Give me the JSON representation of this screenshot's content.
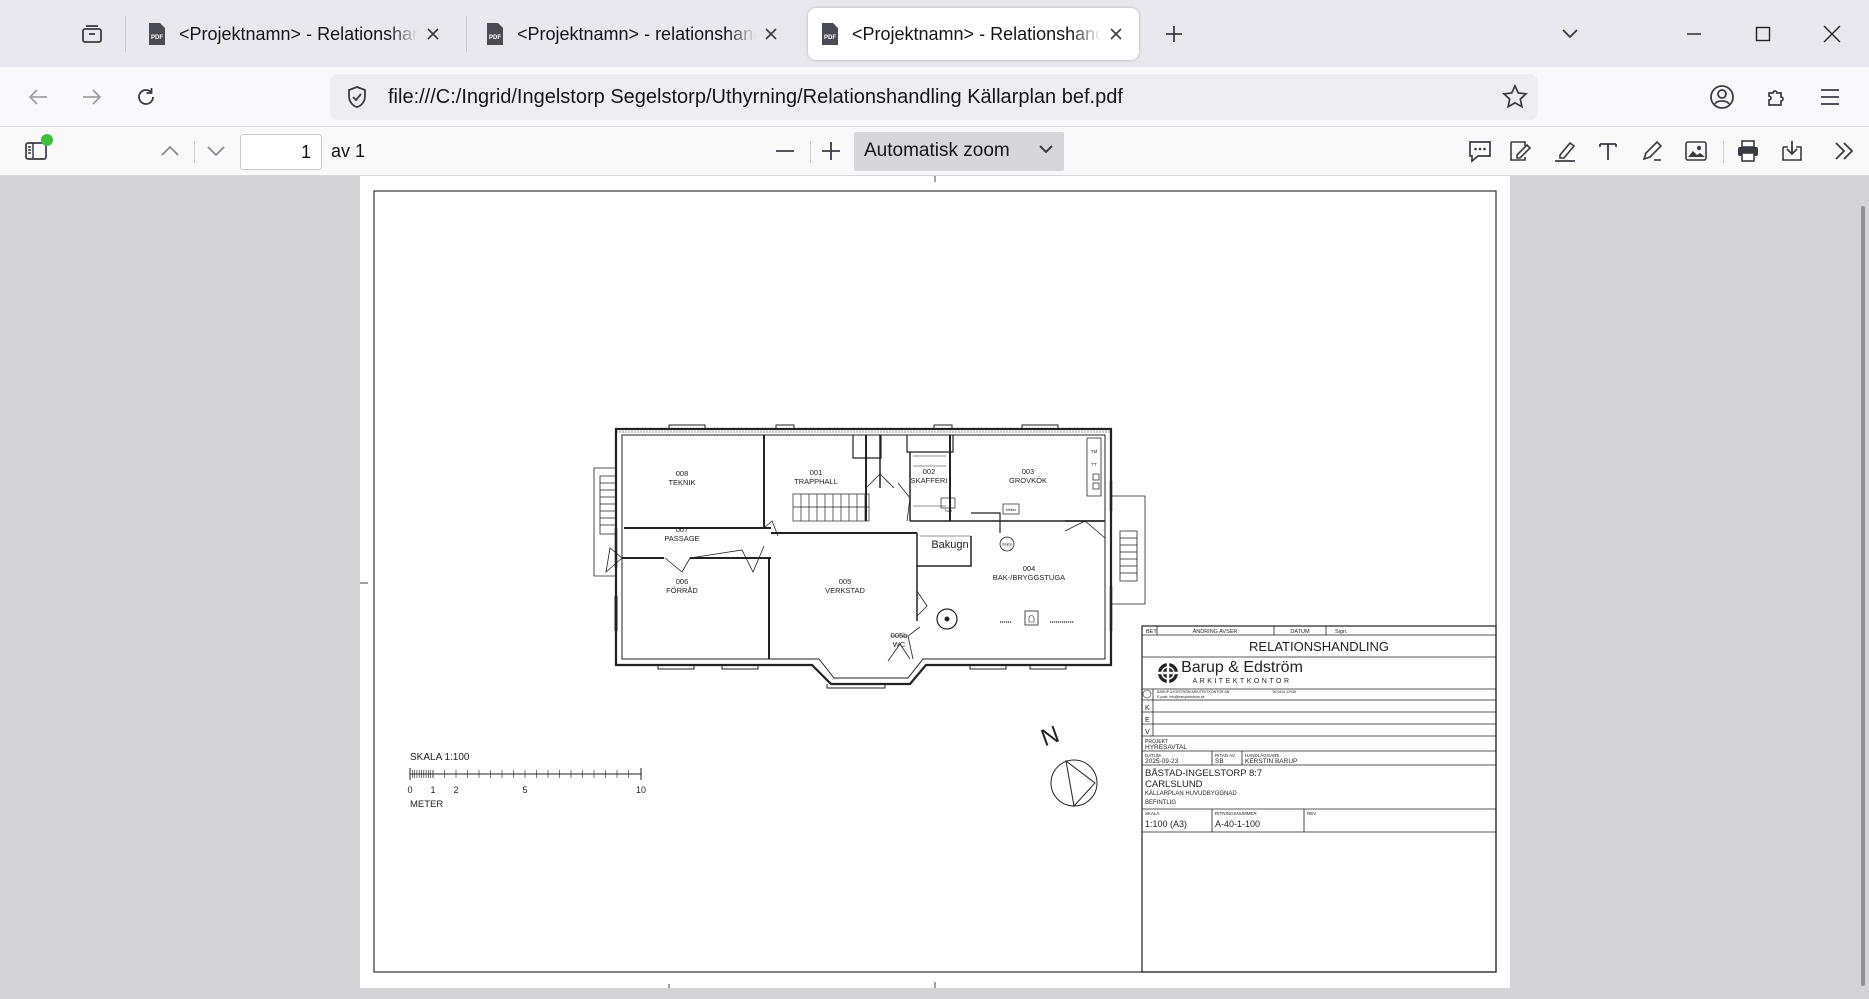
{
  "browser": {
    "tabs": [
      {
        "title": "<Projektnamn> - Relationshandling",
        "active": false
      },
      {
        "title": "<Projektnamn> - relationshandling",
        "active": false
      },
      {
        "title": "<Projektnamn> - Relationshandling",
        "active": true
      }
    ],
    "url": "file:///C:/Ingrid/Ingelstorp Segelstorp/Uthyrning/Relationshandling Källarplan bef.pdf"
  },
  "pdf_toolbar": {
    "page_number": "1",
    "page_count": "av 1",
    "zoom": "Automatisk zoom"
  },
  "drawing": {
    "rooms": [
      {
        "number": "008",
        "name": "TEKNIK"
      },
      {
        "number": "001",
        "name": "TRAPPHALL"
      },
      {
        "number": "002",
        "name": "SKAFFERI"
      },
      {
        "number": "003",
        "name": "GROVKÖK"
      },
      {
        "number": "007",
        "name": "PASSAGE"
      },
      {
        "number": "006",
        "name": "FÖRRÅD"
      },
      {
        "number": "005",
        "name": "VERKSTAD"
      },
      {
        "number": "004",
        "name": "BAK-/BRYGGSTUGA"
      },
      {
        "number": "005b",
        "name": "WC"
      }
    ],
    "bakugn_label": "Bakugn",
    "fixtures": {
      "tm": "TM",
      "tt": "TT",
      "sink": "Diskho",
      "tvatt": "Tvätt",
      "mellan": "Mellan"
    },
    "scale_bar": {
      "title": "SKALA 1:100",
      "ticks": [
        "0",
        "1",
        "2",
        "5",
        "10"
      ],
      "unit": "METER"
    },
    "north_label": "N",
    "title_block": {
      "rev_headers": [
        "BET",
        "ÄNDRING AVSER",
        "DATUM",
        "Sign."
      ],
      "doc_type": "RELATIONSHANDLING",
      "firm_name": "Barup & Edström",
      "firm_sub": "ARKITEKTKONTOR",
      "firm_address": "BARUP & EDSTRÖM ARKITEKTKONTOR AB",
      "firm_phone": "Tel 0414 12938",
      "firm_email": "E-post: info@barupedstrom.se",
      "kev_rows": [
        "K",
        "E",
        "V"
      ],
      "project_label": "PROJEKT",
      "project_value": "HYRESAVTAL",
      "date_label": "DATUM",
      "date_value": "2025-09-23",
      "drawn_label": "RITAD AV",
      "drawn_value": "SB",
      "handler_label": "HANDLÄGGARE",
      "handler_value": "KERSTIN BARUP",
      "property_line1": "BÅSTAD-INGELSTORP 8:7",
      "property_line2": "CARLSLUND",
      "description_line1": "KÄLLARPLAN HUVUDBYGGNAD",
      "description_line2": "BEFINTLIG",
      "scale_label": "SKALA",
      "scale_value": "1:100 (A3)",
      "drawing_no_label": "RITNINGSNUMMER",
      "drawing_no": "A-40-1-100",
      "rev_label": "REV"
    }
  },
  "colors": {
    "tabstrip": "#e8e8ee",
    "viewer": "#d4d4d7",
    "sidebar_dot": "#3fbf3f"
  }
}
